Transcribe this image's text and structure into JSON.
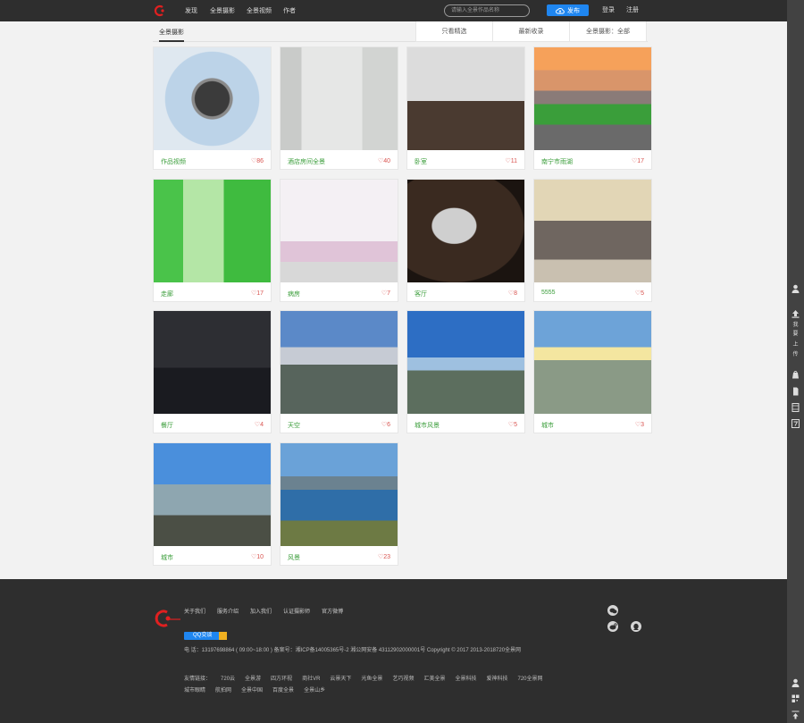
{
  "header": {
    "nav": [
      "发现",
      "全景摄影",
      "全景视频",
      "作者"
    ],
    "search_placeholder": "请输入全景作品名称",
    "publish_label": "发布",
    "login_label": "登录",
    "register_label": "注册"
  },
  "filters": {
    "active_tab": "全景摄影",
    "options": [
      "只看精选",
      "最新收录",
      "全景摄影：全部"
    ]
  },
  "works": [
    {
      "title": "作品视频",
      "likes": "♡86"
    },
    {
      "title": "酒店房间全景",
      "likes": "♡40"
    },
    {
      "title": "卧室",
      "likes": "♡11"
    },
    {
      "title": "南宁市雨湖",
      "likes": "♡17"
    },
    {
      "title": "走廊",
      "likes": "♡17"
    },
    {
      "title": "病房",
      "likes": "♡7"
    },
    {
      "title": "客厅",
      "likes": "♡8"
    },
    {
      "title": "5555",
      "likes": "♡5"
    },
    {
      "title": "餐厅",
      "likes": "♡4"
    },
    {
      "title": "天空",
      "likes": "♡6"
    },
    {
      "title": "城市风景",
      "likes": "♡5"
    },
    {
      "title": "城市",
      "likes": "♡3"
    },
    {
      "title": "城市",
      "likes": "♡10"
    },
    {
      "title": "风景",
      "likes": "♡23"
    }
  ],
  "sidebar": {
    "upload_text": [
      "我",
      "要",
      "上",
      "传"
    ]
  },
  "footer": {
    "links": [
      "关于我们",
      "服务介绍",
      "加入我们",
      "认证摄影师",
      "官方微博"
    ],
    "qq_label": "QQ交谈",
    "contact": "电 话：13197698864 ( 09:00~18:00 ) 备案号：湘ICP备14005365号-2 湘公网安备 43112902000001号      Copyright © 2017 2013-2018720全景网",
    "friends_label": "友情链接：",
    "friends_row1": [
      "720云",
      "全景游",
      "四方环视",
      "商社VR",
      "云景天下",
      "光鱼全景",
      "艺巧视频",
      "汇美全景",
      "全景科技",
      "爱神科技",
      "720全景网"
    ],
    "friends_row2": [
      "城市眼睛",
      "航拍网",
      "全景中国",
      "百度全景",
      "全景山乡"
    ]
  },
  "colors": {
    "accent": "#1f86f0",
    "title_green": "#3a9d3a",
    "likes_red": "#d9534f",
    "dark_bg": "#2e2e2e"
  }
}
